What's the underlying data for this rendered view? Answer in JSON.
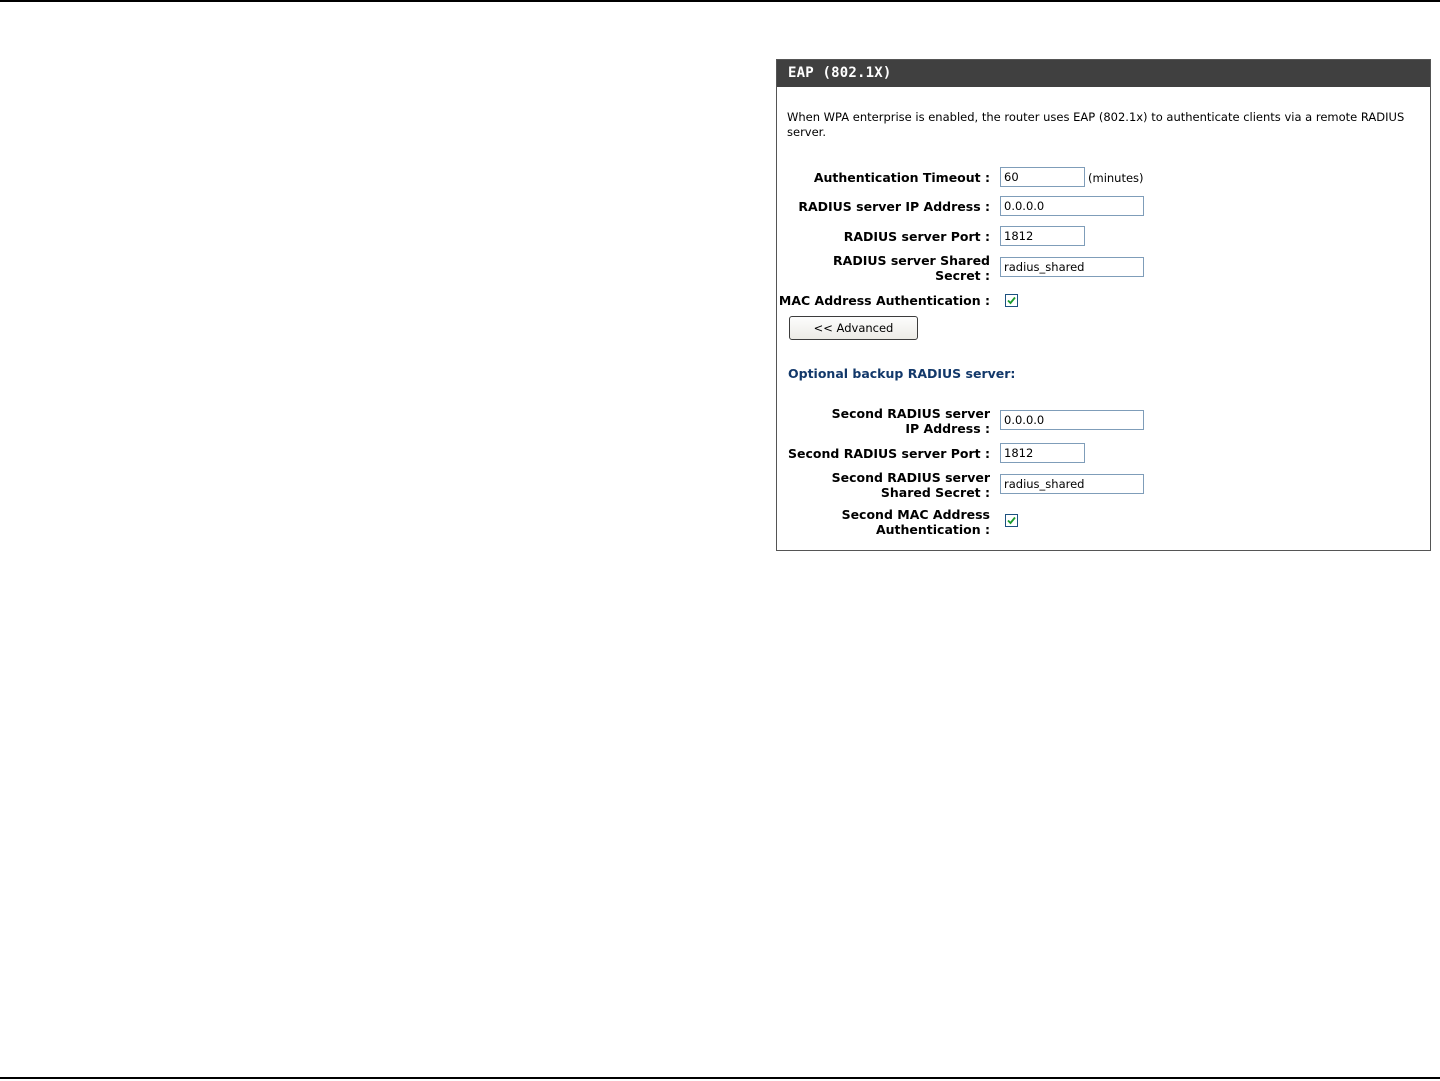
{
  "panel": {
    "title": "EAP (802.1X)",
    "description": "When WPA enterprise is enabled, the router uses EAP (802.1x) to authenticate clients via a remote RADIUS server."
  },
  "primary": {
    "auth_timeout": {
      "label": "Authentication Timeout :",
      "value": "60",
      "unit": "(minutes)"
    },
    "radius_ip": {
      "label": "RADIUS server IP Address :",
      "value": "0.0.0.0"
    },
    "radius_port": {
      "label": "RADIUS server Port :",
      "value": "1812"
    },
    "radius_secret": {
      "label": "RADIUS server Shared Secret :",
      "value": "radius_shared"
    },
    "mac_auth": {
      "label": "MAC Address Authentication :",
      "checked": true
    }
  },
  "advanced_button": {
    "label": "<< Advanced"
  },
  "backup": {
    "section_title": "Optional backup RADIUS server:",
    "radius_ip": {
      "label": "Second RADIUS server IP Address :",
      "value": "0.0.0.0"
    },
    "radius_port": {
      "label": "Second RADIUS server Port :",
      "value": "1812"
    },
    "radius_secret": {
      "label": "Second RADIUS server Shared Secret :",
      "value": "radius_shared"
    },
    "mac_auth": {
      "label": "Second MAC Address Authentication :",
      "checked": true
    }
  },
  "colors": {
    "header_bg": "#404040",
    "header_text": "#ffffff",
    "section_title": "#12386a",
    "checkbox_check": "#1a9a2c"
  }
}
